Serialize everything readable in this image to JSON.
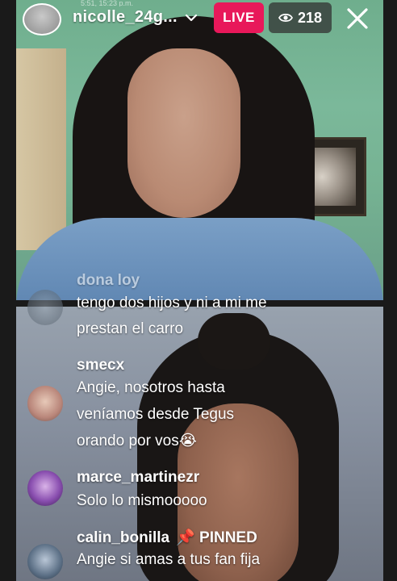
{
  "status_bar": {
    "time": "5:51, 15:23 p.m."
  },
  "header": {
    "username": "nicolle_24g...",
    "live_label": "LIVE",
    "viewer_count": "218",
    "accent_live": "#e8185a"
  },
  "comments": [
    {
      "user": "dona loy",
      "lines": [
        "tengo dos hijos y ni a mi me",
        "prestan el carro"
      ],
      "faded": true
    },
    {
      "user": "smecx",
      "lines": [
        "Angie, nosotros hasta",
        "veníamos desde Tegus",
        "orando por vos😭"
      ]
    },
    {
      "user": "marce_martinezr",
      "lines": [
        "Solo lo mismooooo"
      ]
    },
    {
      "user": "calin_bonilla",
      "pinned_label": "📌 PINNED",
      "lines": [
        "Angie si amas a tus fan fija"
      ]
    }
  ],
  "icons": {
    "profile": "avatar",
    "chevron": "chevron-down-icon",
    "viewers": "eye-icon",
    "close": "close-icon"
  }
}
